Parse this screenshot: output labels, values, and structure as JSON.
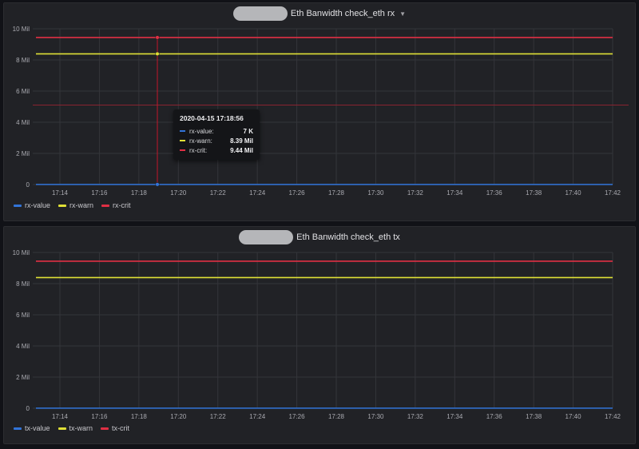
{
  "colors": {
    "value": "#3274d9",
    "warn": "#e0e036",
    "crit": "#e02f44",
    "grid": "#34353a",
    "axis_text": "#a9aab0"
  },
  "panels": [
    {
      "title": "Eth Banwidth check_eth rx",
      "legend": [
        {
          "label": "rx-value",
          "color": "#3274d9"
        },
        {
          "label": "rx-warn",
          "color": "#e0e036"
        },
        {
          "label": "rx-crit",
          "color": "#e02f44"
        }
      ],
      "tooltip": {
        "time": "2020-04-15 17:18:56",
        "rows": [
          {
            "label": "rx-value:",
            "value": "7 K",
            "color": "#3274d9"
          },
          {
            "label": "rx-warn:",
            "value": "8.39 Mil",
            "color": "#e0e036"
          },
          {
            "label": "rx-crit:",
            "value": "9.44 Mil",
            "color": "#e02f44"
          }
        ]
      }
    },
    {
      "title": "Eth Banwidth check_eth tx",
      "legend": [
        {
          "label": "tx-value",
          "color": "#3274d9"
        },
        {
          "label": "tx-warn",
          "color": "#e0e036"
        },
        {
          "label": "tx-crit",
          "color": "#e02f44"
        }
      ]
    }
  ],
  "chart_data": [
    {
      "type": "line",
      "title": "Eth Banwidth check_eth rx",
      "x_ticks": [
        "17:14",
        "17:16",
        "17:18",
        "17:20",
        "17:22",
        "17:24",
        "17:26",
        "17:28",
        "17:30",
        "17:32",
        "17:34",
        "17:36",
        "17:38",
        "17:40",
        "17:42"
      ],
      "y_ticks": [
        "0",
        "2 Mil",
        "4 Mil",
        "6 Mil",
        "8 Mil",
        "10 Mil"
      ],
      "ylim": [
        0,
        10000000
      ],
      "xlim_minutes": [
        17.3,
        17.42
      ],
      "series": [
        {
          "name": "rx-value",
          "color": "#3274d9",
          "y": [
            7000,
            7000
          ]
        },
        {
          "name": "rx-warn",
          "color": "#e0e036",
          "y": [
            8390000,
            8390000
          ]
        },
        {
          "name": "rx-crit",
          "color": "#e02f44",
          "y": [
            9440000,
            9440000
          ]
        }
      ],
      "threshold_line": 5100000,
      "hover_time": "17:18:56"
    },
    {
      "type": "line",
      "title": "Eth Banwidth check_eth tx",
      "x_ticks": [
        "17:14",
        "17:16",
        "17:18",
        "17:20",
        "17:22",
        "17:24",
        "17:26",
        "17:28",
        "17:30",
        "17:32",
        "17:34",
        "17:36",
        "17:38",
        "17:40",
        "17:42"
      ],
      "y_ticks": [
        "0",
        "2 Mil",
        "4 Mil",
        "6 Mil",
        "8 Mil",
        "10 Mil"
      ],
      "ylim": [
        0,
        10000000
      ],
      "series": [
        {
          "name": "tx-value",
          "color": "#3274d9",
          "y": [
            7000,
            7000
          ]
        },
        {
          "name": "tx-warn",
          "color": "#e0e036",
          "y": [
            8390000,
            8390000
          ]
        },
        {
          "name": "tx-crit",
          "color": "#e02f44",
          "y": [
            9440000,
            9440000
          ]
        }
      ]
    }
  ]
}
